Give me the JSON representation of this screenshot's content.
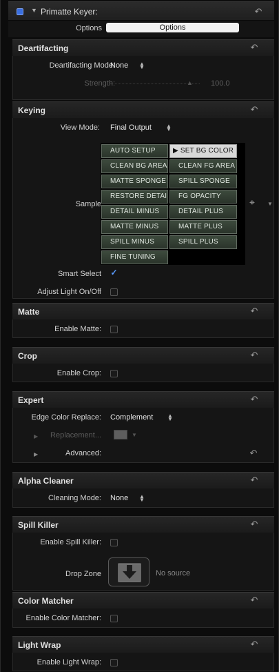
{
  "header": {
    "title": "Primatte Keyer:",
    "options_label": "Options",
    "options_button": "Options",
    "accent": "#3a6fe0"
  },
  "deartifacting": {
    "title": "Deartifacting",
    "mode_label": "Deartifacting Mode:",
    "mode_value": "None",
    "strength_label": "Strength:",
    "strength_value": "100.0"
  },
  "keying": {
    "title": "Keying",
    "view_mode_label": "View Mode:",
    "view_mode_value": "Final Output",
    "sample_label": "Sample",
    "buttons": [
      "AUTO SETUP",
      "SET BG COLOR",
      "CLEAN BG AREA",
      "CLEAN FG AREA",
      "MATTE SPONGE",
      "SPILL SPONGE",
      "RESTORE DETAIL",
      "FG OPACITY",
      "DETAIL MINUS",
      "DETAIL PLUS",
      "MATTE MINUS",
      "MATTE PLUS",
      "SPILL MINUS",
      "SPILL PLUS",
      "FINE TUNING"
    ],
    "smart_select_label": "Smart Select",
    "smart_select_checked": true,
    "adjust_light_label": "Adjust Light On/Off",
    "adjust_light_checked": false
  },
  "matte": {
    "title": "Matte",
    "enable_label": "Enable Matte:"
  },
  "crop": {
    "title": "Crop",
    "enable_label": "Enable Crop:"
  },
  "expert": {
    "title": "Expert",
    "edge_label": "Edge Color Replace:",
    "edge_value": "Complement",
    "replacement_label": "Replacement...",
    "advanced_label": "Advanced:"
  },
  "alpha_cleaner": {
    "title": "Alpha Cleaner",
    "mode_label": "Cleaning Mode:",
    "mode_value": "None"
  },
  "spill_killer": {
    "title": "Spill Killer",
    "enable_label": "Enable Spill Killer:",
    "drop_zone_label": "Drop Zone",
    "drop_zone_status": "No source"
  },
  "color_matcher": {
    "title": "Color Matcher",
    "enable_label": "Enable Color Matcher:"
  },
  "light_wrap": {
    "title": "Light Wrap",
    "enable_label": "Enable Light Wrap:"
  }
}
